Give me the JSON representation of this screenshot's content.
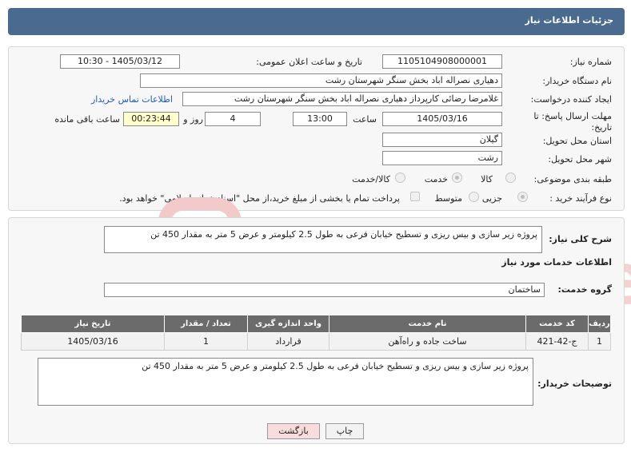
{
  "header": {
    "title": "جزئیات اطلاعات نیاز"
  },
  "fields": {
    "need_number_label": "شماره نیاز:",
    "need_number": "1105104908000001",
    "announce_label": "تاریخ و ساعت اعلان عمومی:",
    "announce_value": "1405/03/12 - 10:30",
    "buyer_org_label": "نام دستگاه خریدار:",
    "buyer_org": "دهیاری نصراله اباد بخش سنگر شهرستان رشت",
    "creator_label": "ایجاد کننده درخواست:",
    "creator": "غلامرضا رضائی کارپرداز دهیاری نصراله اباد بخش سنگر شهرستان رشت",
    "contact_link": "اطلاعات تماس خریدار",
    "deadline_label": "مهلت ارسال پاسخ: تا تاریخ:",
    "deadline_date": "1405/03/16",
    "time_label": "ساعت",
    "deadline_time": "13:00",
    "days_value": "4",
    "days_label": "روز و",
    "remaining_time": "00:23:44",
    "remaining_label": "ساعت باقی مانده",
    "province_label": "استان محل تحویل:",
    "province": "گیلان",
    "city_label": "شهر محل تحویل:",
    "city": "رشت",
    "category_label": "طبقه بندی موضوعی:",
    "category_options": [
      "کالا",
      "خدمت",
      "کالا/خدمت"
    ],
    "process_label": "نوع فرآیند خرید :",
    "process_options": [
      "جزیی",
      "متوسط"
    ],
    "payment_note": "پرداخت تمام یا بخشی از مبلغ خرید،از محل \"اسناد خزانه اسلامی\" خواهد بود."
  },
  "description": {
    "label": "شرح کلی نیاز:",
    "value": "پروژه زیر سازی و بیس ریزی و تسطیح خیابان فرعی به طول 2.5 کیلومتر و عرض 5 متر به مقدار 450 تن"
  },
  "services": {
    "section_title": "اطلاعات خدمات مورد نیاز",
    "group_label": "گروه خدمت:",
    "group_value": "ساختمان",
    "columns": [
      "ردیف",
      "کد خدمت",
      "نام خدمت",
      "واحد اندازه گیری",
      "تعداد / مقدار",
      "تاریخ نیاز"
    ],
    "rows": [
      [
        "1",
        "ج-42-421",
        "ساخت جاده و راه‌آهن",
        "قرارداد",
        "1",
        "1405/03/16"
      ]
    ]
  },
  "buyer_notes": {
    "label": "توضیحات خریدار:",
    "value": "پروژه زیر سازی و بیس ریزی و تسطیح خیابان فرعی به طول 2.5 کیلومتر و عرض 5 متر به مقدار 450 تن"
  },
  "buttons": {
    "print": "چاپ",
    "back": "بازگشت"
  },
  "colors": {
    "header": "#4a6a8f",
    "table_header": "#6b6b6b",
    "back_button": "#f9dcdc",
    "remaining_bg": "#ffffcc"
  }
}
